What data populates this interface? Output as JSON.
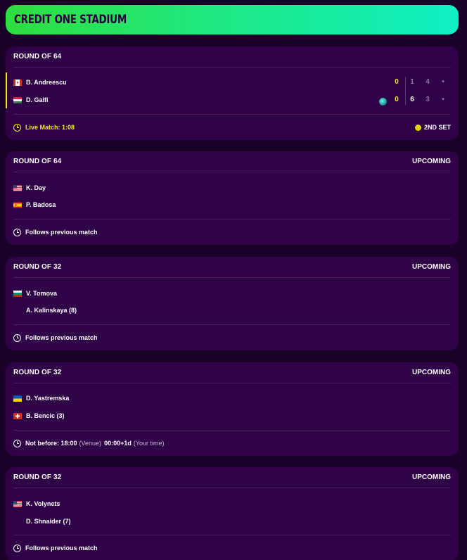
{
  "header": {
    "title": "CREDIT ONE STADIUM"
  },
  "matches": [
    {
      "round": "ROUND OF 64",
      "status": "",
      "players": [
        {
          "name": "B. Andreescu",
          "flag": "canada-flag-icon",
          "game": "0",
          "sets": [
            "1",
            "4",
            "•"
          ]
        },
        {
          "name": "D. Galfi",
          "flag": "hungary-flag-icon",
          "game": "0",
          "sets": [
            "6",
            "3",
            "•"
          ],
          "serving": true
        }
      ],
      "footer": {
        "text": "Live Match: 1:08",
        "set_label": "2ND SET"
      }
    },
    {
      "round": "ROUND OF 64",
      "status": "UPCOMING",
      "players": [
        {
          "name": "K. Day",
          "flag": "usa-flag-icon"
        },
        {
          "name": "P. Badosa",
          "flag": "spain-flag-icon"
        }
      ],
      "footer": {
        "text": "Follows previous match"
      }
    },
    {
      "round": "ROUND OF 32",
      "status": "UPCOMING",
      "players": [
        {
          "name": "V. Tomova",
          "flag": "bulgaria-flag-icon"
        },
        {
          "name": "A. Kalinskaya (8)",
          "flag": ""
        }
      ],
      "footer": {
        "text": "Follows previous match"
      }
    },
    {
      "round": "ROUND OF 32",
      "status": "UPCOMING",
      "players": [
        {
          "name": "D. Yastremska",
          "flag": "ukraine-flag-icon"
        },
        {
          "name": "B. Bencic (3)",
          "flag": "switzerland-flag-icon"
        }
      ],
      "footer": {
        "text": "Not before: 18:00",
        "venue": "(Venue)",
        "local_time": "00:00+1d",
        "your_time": "(Your time)"
      }
    },
    {
      "round": "ROUND OF 32",
      "status": "UPCOMING",
      "players": [
        {
          "name": "K. Volynets",
          "flag": "usa-flag-icon"
        },
        {
          "name": "D. Shnaider (7)",
          "flag": ""
        }
      ],
      "footer": {
        "text": "Follows previous match"
      }
    }
  ],
  "colors": {
    "background": "#1a0128",
    "card": "#2f0147",
    "live_accent": "#f5e81a",
    "header_gradient_start": "#2fde3e",
    "header_gradient_end": "#0ff0c4"
  }
}
